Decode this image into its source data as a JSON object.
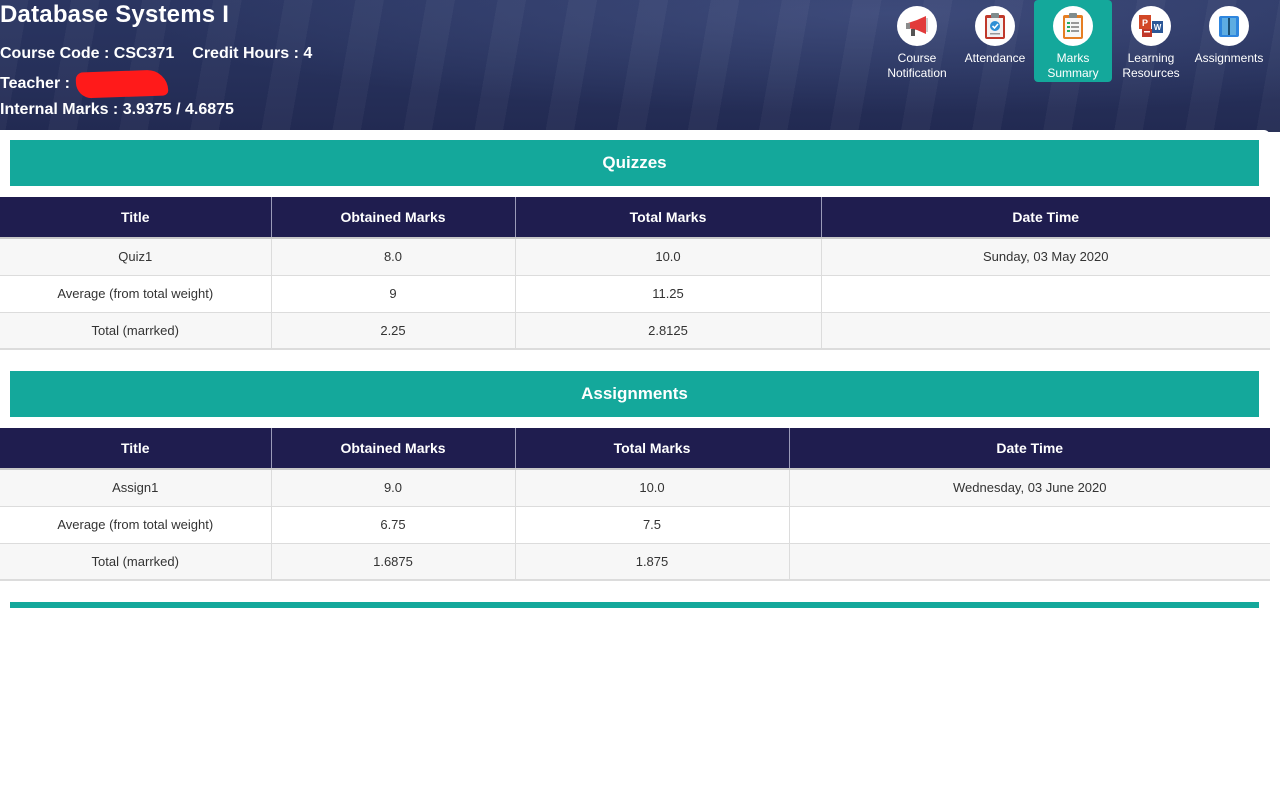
{
  "course": {
    "title": "Database Systems I",
    "code_line": "Course Code : CSC371",
    "credit_line": "Credit Hours : 4",
    "teacher_label": "Teacher :",
    "internal_marks": "Internal Marks : 3.9375 / 4.6875"
  },
  "nav": [
    {
      "label": "Course\nNotification",
      "icon": "megaphone-icon"
    },
    {
      "label": "Attendance",
      "icon": "clipboard-check-icon"
    },
    {
      "label": "Marks\nSummary",
      "icon": "clipboard-list-icon",
      "active": true
    },
    {
      "label": "Learning\nResources",
      "icon": "office-docs-icon"
    },
    {
      "label": "Assignments",
      "icon": "book-icon"
    }
  ],
  "columns": [
    "Title",
    "Obtained Marks",
    "Total Marks",
    "Date Time"
  ],
  "quizzes": {
    "heading": "Quizzes",
    "rows": [
      [
        "Quiz1",
        "8.0",
        "10.0",
        "Sunday, 03 May 2020"
      ],
      [
        "Average (from total weight)",
        "9",
        "11.25",
        ""
      ],
      [
        "Total (marrked)",
        "2.25",
        "2.8125",
        ""
      ]
    ]
  },
  "assignments": {
    "heading": "Assignments",
    "rows": [
      [
        "Assign1",
        "9.0",
        "10.0",
        "Wednesday, 03 June 2020"
      ],
      [
        "Average (from total weight)",
        "6.75",
        "7.5",
        ""
      ],
      [
        "Total (marrked)",
        "1.6875",
        "1.875",
        ""
      ]
    ]
  },
  "colors": {
    "header_bg": "#26305a",
    "accent_teal": "#14a89b",
    "table_header": "#1f1d4f",
    "redaction": "#ff1a1a"
  }
}
